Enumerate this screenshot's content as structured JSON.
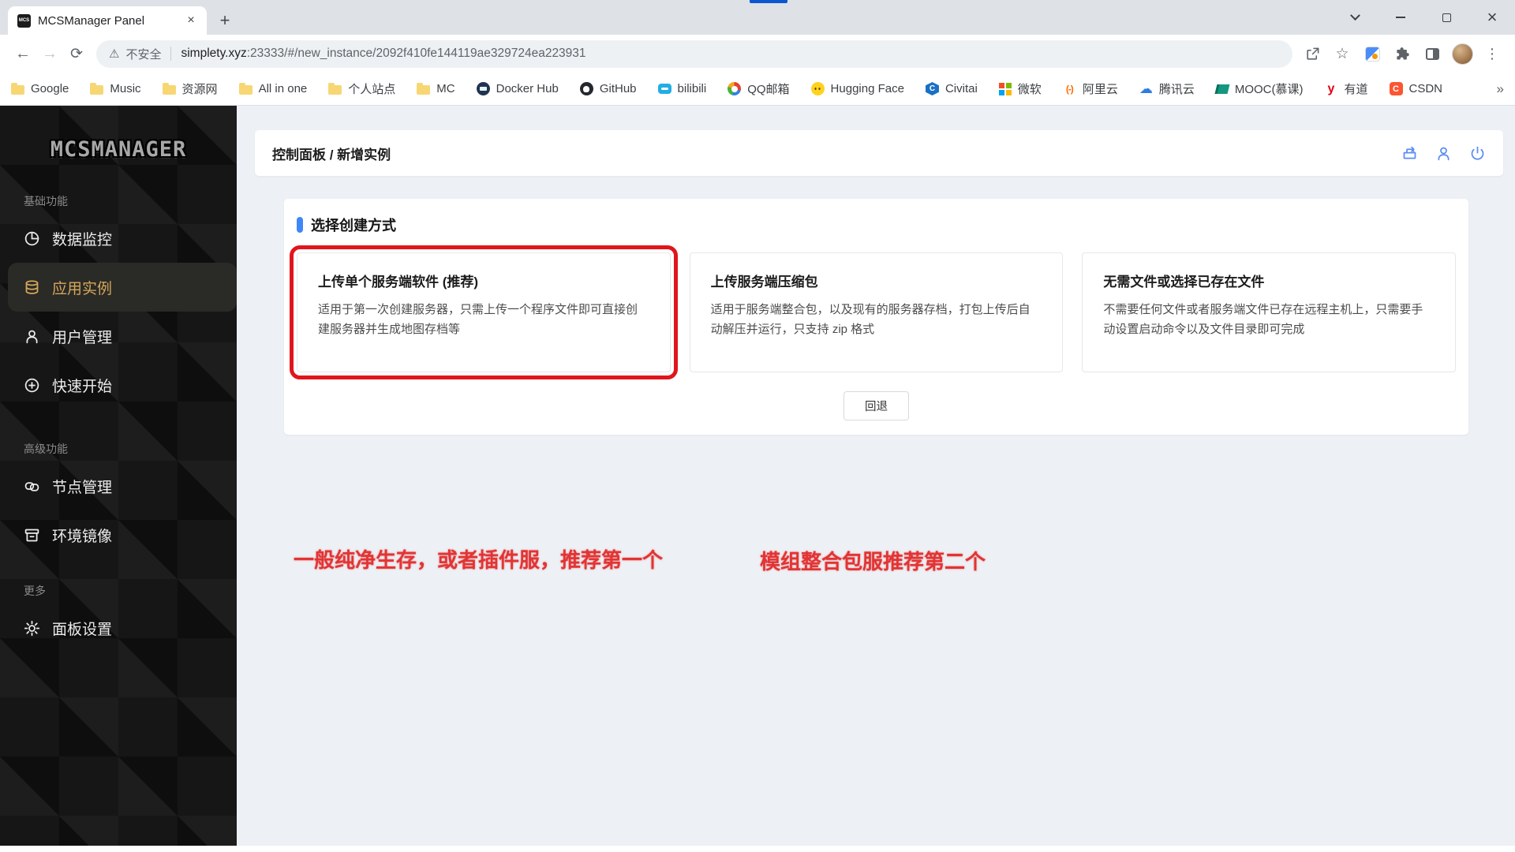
{
  "browser": {
    "tab_title": "MCSManager Panel",
    "address": {
      "security_text": "不安全",
      "url_host": "simplety.xyz",
      "url_rest": ":23333/#/new_instance/2092f410fe144119ae329724ea223931"
    },
    "bookmarks": [
      {
        "label": "Google",
        "icon": "folder-icon"
      },
      {
        "label": "Music",
        "icon": "folder-icon"
      },
      {
        "label": "资源网",
        "icon": "folder-icon"
      },
      {
        "label": "All in one",
        "icon": "folder-icon"
      },
      {
        "label": "个人站点",
        "icon": "folder-icon"
      },
      {
        "label": "MC",
        "icon": "folder-icon"
      },
      {
        "label": "Docker Hub",
        "icon": "docker-icon"
      },
      {
        "label": "GitHub",
        "icon": "github-icon"
      },
      {
        "label": "bilibili",
        "icon": "bilibili-icon"
      },
      {
        "label": "QQ邮箱",
        "icon": "qq-mail-icon"
      },
      {
        "label": "Hugging Face",
        "icon": "hugging-face-icon"
      },
      {
        "label": "Civitai",
        "icon": "civitai-icon"
      },
      {
        "label": "微软",
        "icon": "microsoft-icon"
      },
      {
        "label": "阿里云",
        "icon": "aliyun-icon"
      },
      {
        "label": "腾讯云",
        "icon": "tencent-cloud-icon"
      },
      {
        "label": "MOOC(慕课)",
        "icon": "mooc-icon"
      },
      {
        "label": "有道",
        "icon": "youdao-icon"
      },
      {
        "label": "CSDN",
        "icon": "csdn-icon"
      }
    ]
  },
  "sidebar": {
    "logo": "MCSMANAGER",
    "sections": [
      {
        "label": "基础功能",
        "items": [
          {
            "label": "数据监控",
            "icon": "pie-chart-icon",
            "active": false
          },
          {
            "label": "应用实例",
            "icon": "database-icon",
            "active": true
          },
          {
            "label": "用户管理",
            "icon": "user-icon",
            "active": false
          },
          {
            "label": "快速开始",
            "icon": "plus-circle-icon",
            "active": false
          }
        ]
      },
      {
        "label": "高级功能",
        "items": [
          {
            "label": "节点管理",
            "icon": "link-icon",
            "active": false
          },
          {
            "label": "环境镜像",
            "icon": "archive-box-icon",
            "active": false
          }
        ]
      },
      {
        "label": "更多",
        "items": [
          {
            "label": "面板设置",
            "icon": "gear-icon",
            "active": false
          }
        ]
      }
    ]
  },
  "header": {
    "breadcrumb": "控制面板 / 新增实例",
    "icons": [
      "box-arrow-icon",
      "user-icon",
      "power-icon"
    ]
  },
  "main": {
    "panel_title": "选择创建方式",
    "cards": [
      {
        "title": "上传单个服务端软件 (推荐)",
        "desc": "适用于第一次创建服务器，只需上传一个程序文件即可直接创建服务器并生成地图存档等",
        "highlighted": true
      },
      {
        "title": "上传服务端压缩包",
        "desc": "适用于服务端整合包，以及现有的服务器存档，打包上传后自动解压并运行，只支持 zip 格式",
        "highlighted": false
      },
      {
        "title": "无需文件或选择已存在文件",
        "desc": "不需要任何文件或者服务端文件已存在远程主机上，只需要手动设置启动命令以及文件目录即可完成",
        "highlighted": false
      }
    ],
    "back_button": "回退",
    "annotations": [
      "一般纯净生存，或者插件服，推荐第一个",
      "模组整合包服推荐第二个"
    ]
  },
  "colors": {
    "accent_blue": "#3e87f8",
    "header_icon_blue": "#5b8cf5",
    "sidebar_active_gold": "#d5a85a",
    "annotation_red": "#e23434",
    "highlight_box_red": "#e1151c",
    "sidebar_bg": "#161616",
    "main_bg": "#edf0f4"
  }
}
